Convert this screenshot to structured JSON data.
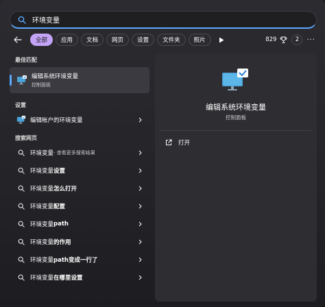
{
  "search": {
    "value": "环境变量",
    "icon": "search-icon"
  },
  "filters": {
    "back_icon": "back-arrow-icon",
    "chips": [
      "全部",
      "应用",
      "文档",
      "网页",
      "设置",
      "文件夹",
      "照片"
    ],
    "play_icon": "play-icon",
    "count": "829",
    "trophy_icon": "trophy-icon",
    "badge": "2",
    "more": "···"
  },
  "best_match": {
    "section": "最佳匹配",
    "title": "编辑系统环境变量",
    "subtitle": "控制面板"
  },
  "settings": {
    "section": "设置",
    "item": "编辑帐户的环境变量"
  },
  "web": {
    "section": "搜索网页",
    "first_main": "环境变量",
    "first_sub": " - 查看更多搜索结果",
    "items": [
      {
        "prefix": "环境变量",
        "bold": "设置"
      },
      {
        "prefix": "环境变量",
        "bold": "怎么打开"
      },
      {
        "prefix": "环境变量",
        "bold": "配置"
      },
      {
        "prefix": "环境变量",
        "bold": "path"
      },
      {
        "prefix": "环境变量",
        "bold": "的作用"
      },
      {
        "prefix": "环境变量",
        "bold": "path变成一行了"
      },
      {
        "prefix": "环境变量",
        "bold": "在哪里设置"
      }
    ]
  },
  "detail": {
    "title": "编辑系统环境变量",
    "subtitle": "控制面板",
    "open_label": "打开"
  },
  "colors": {
    "accent": "#5aa9ff",
    "chip_active": "#c3a3f5"
  }
}
